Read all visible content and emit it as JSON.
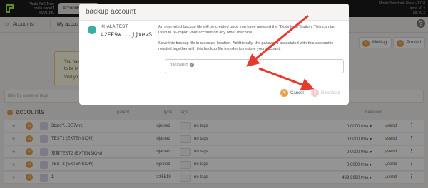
{
  "topbar": {
    "chain_lines": [
      "Phala PoC-Next",
      "phala node/1",
      "#909,390"
    ],
    "nav_label": "Accounts",
    "right_info": [
      "Phala Substrate Node v1.0.0",
      "apps v0.x",
      "api v0.x"
    ]
  },
  "subnav": {
    "accounts_label": "Accounts",
    "my_accounts_label": "My accou"
  },
  "buttons": {
    "multisig": "Multisig",
    "proxied": "Proxied"
  },
  "warning": {
    "line1": "You hav",
    "line2": "to be in",
    "line3": "Visit yo"
  },
  "filter": {
    "placeholder": "filter by name or tags"
  },
  "list": {
    "title": "accounts",
    "headers": {
      "parent": "parent",
      "type": "type",
      "tags": "tags",
      "balances": "balances"
    },
    "rows": [
      {
        "avatar": "A",
        "name": "3zsrcY...DE7wrc",
        "type": "injected",
        "tags": "no tags",
        "balance": "0.0000",
        "unit": "PHA",
        "send": "send"
      },
      {
        "avatar": "A",
        "name": "TEST1 (EXTENSION)",
        "type": "injected",
        "tags": "no tags",
        "balance": "0.0000",
        "unit": "PHA",
        "send": "send"
      },
      {
        "avatar": "A",
        "name": "草莓TEST2 (EXTENSION)",
        "type": "injected",
        "tags": "no tags",
        "balance": "0.0000",
        "unit": "PHA",
        "send": "send"
      },
      {
        "avatar": "A",
        "name": "TEST3 (EXTENSION)",
        "type": "injected",
        "tags": "no tags",
        "balance": "0.0000",
        "unit": "PHA",
        "send": "send"
      },
      {
        "avatar": "A",
        "name": "1",
        "type": "sr25519",
        "tags": "no tags",
        "balance": "499.9990",
        "unit": "PHA",
        "send": "send"
      }
    ]
  },
  "modal": {
    "title": "backup account",
    "account_name": "KHALA TEST",
    "account_address": "42FE9W...jjxevS",
    "paragraph1": "An encrypted backup file will be created once you have pressed the \"Download\" button. This can be used to re-import your account on any other machine.",
    "paragraph2": "Save this backup file in a secure location. Additionally, the password associated with this account is needed together with this backup file in order to restore your account.",
    "password_label": "password",
    "cancel_label": "Cancel",
    "download_label": "Download"
  },
  "colors": {
    "accent": "#e8a14a",
    "arrow": "#e53a2c",
    "topbar": "#1a1a1a"
  }
}
